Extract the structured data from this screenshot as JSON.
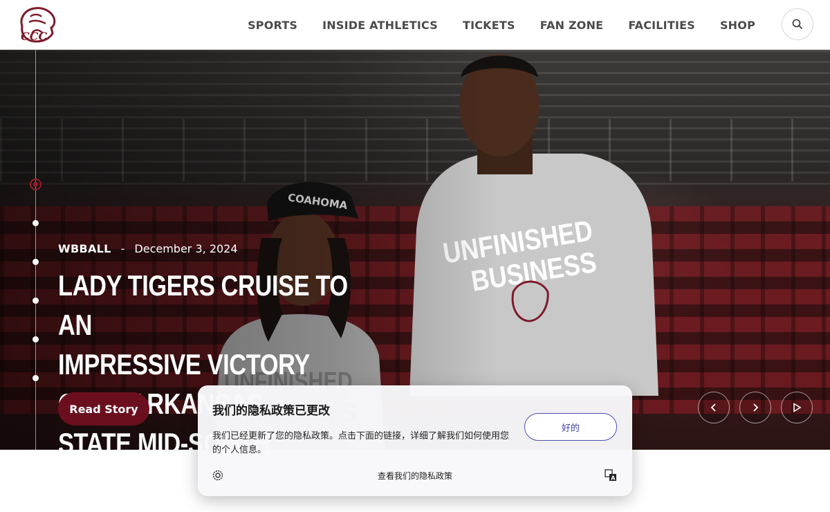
{
  "nav": {
    "items": [
      "SPORTS",
      "INSIDE ATHLETICS",
      "TICKETS",
      "FAN ZONE",
      "FACILITIES",
      "SHOP"
    ]
  },
  "hero": {
    "sport": "WBBALL",
    "separator": "-",
    "date": "December 3, 2024",
    "headline_lines": [
      "Lady Tigers Cruise to an",
      "Impressive Victory over Arkansas",
      "State Mid-South"
    ],
    "read_button": "Read Story",
    "slide_count": 6,
    "active_slide": 1
  },
  "privacy": {
    "title": "我们的隐私政策已更改",
    "body": "我们已经更新了您的隐私政策。点击下面的链接，详细了解我们如何使用您的个人信息。",
    "ok_button": "好的",
    "link": "查看我们的隐私政策"
  },
  "colors": {
    "brand_maroon": "#6b0f1f",
    "accent_red": "#9b1b2a",
    "button_outline": "#4a4fb0"
  },
  "icons": [
    "tiger-logo-icon",
    "search-icon",
    "chevron-left-icon",
    "chevron-right-icon",
    "play-icon",
    "gear-icon",
    "translate-icon"
  ]
}
